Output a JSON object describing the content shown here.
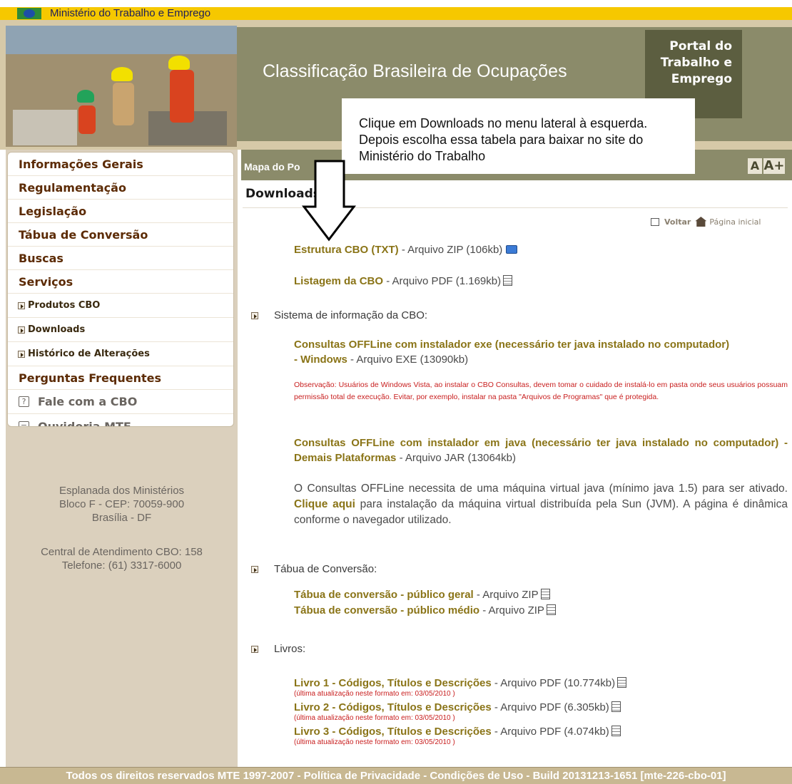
{
  "gov_bar": {
    "text": "Ministério do Trabalho e Emprego"
  },
  "header": {
    "site_title": "Classificação Brasileira de Ocupações",
    "portal_line1": "Portal do",
    "portal_line2": "Trabalho e",
    "portal_line3": "Emprego"
  },
  "annotation": {
    "text": "Clique em Downloads no menu lateral à esquerda. Depois escolha essa tabela para baixar no site do Ministério do Trabalho"
  },
  "sidebar": {
    "items": [
      {
        "label": "Informações Gerais"
      },
      {
        "label": "Regulamentação"
      },
      {
        "label": "Legislação"
      },
      {
        "label": "Tábua de Conversão"
      },
      {
        "label": "Buscas"
      },
      {
        "label": "Serviços"
      },
      {
        "label": "Produtos CBO"
      },
      {
        "label": "Downloads"
      },
      {
        "label": "Histórico de Alterações"
      },
      {
        "label": "Perguntas Frequentes"
      },
      {
        "label": "Fale com a CBO"
      },
      {
        "label": "Ouvidoria MTE"
      }
    ],
    "address_1": "Esplanada dos Ministérios",
    "address_2": "Bloco F - CEP: 70059-900",
    "address_3": "Brasília - DF",
    "contact_1": "Central de Atendimento CBO: 158",
    "contact_2": "Telefone: (61) 3317-6000"
  },
  "toolbar": {
    "mapa_label": "Mapa do Po",
    "font_small": "A",
    "font_large": "A+"
  },
  "content": {
    "heading": "Downloads",
    "back_label": "Voltar",
    "home_label": "Página inicial",
    "file1": {
      "link": "Estrutura CBO (TXT)",
      "desc": " - Arquivo ZIP (106kb)"
    },
    "file2": {
      "link": "Listagem da CBO",
      "desc": " - Arquivo PDF (1.169kb)"
    },
    "section_sistema": "Sistema de informação da CBO:",
    "offline_exe": {
      "link_part1": "Consultas OFFLine com instalador exe (necessário ter java instalado no computador)",
      "link_part2": "- Windows",
      "desc": " - Arquivo EXE (13090kb)"
    },
    "observacao": "Observação: Usuários de Windows Vista, ao instalar o CBO Consultas, devem tomar o cuidado de instalá-lo em pasta onde seus usuários possuam permissão total de execução. Evitar, por exemplo, instalar na pasta \"Arquivos de Programas\" que é protegida.",
    "offline_java": {
      "link": "Consultas OFFLine com instalador em java (necessário ter java instalado no computador) - Demais Plataformas",
      "desc": " - Arquivo JAR (13064kb)"
    },
    "jvm_text_1": "O Consultas OFFLine necessita de uma máquina virtual java (mínimo java 1.5) para ser ativado. ",
    "jvm_link": "Clique aqui",
    "jvm_text_2": " para instalação da máquina virtual distribuída pela Sun (JVM). A página é dinâmica conforme o navegador utilizado.",
    "section_tabua": "Tábua de Conversão:",
    "tabua1": {
      "link": "Tábua de conversão - público geral",
      "desc": " - Arquivo ZIP"
    },
    "tabua2": {
      "link": "Tábua de conversão - público médio",
      "desc": " - Arquivo ZIP"
    },
    "section_livros": "Livros:",
    "livro1": {
      "link": "Livro 1 - Códigos, Títulos e Descrições",
      "desc": " - Arquivo PDF (10.774kb)",
      "note": "(última atualização neste formato em: 03/05/2010 )"
    },
    "livro2": {
      "link": "Livro 2 - Códigos, Títulos e Descrições",
      "desc": " - Arquivo PDF (6.305kb)",
      "note": "(última atualização neste formato em: 03/05/2010 )"
    },
    "livro3": {
      "link": "Livro 3 - Códigos, Títulos e Descrições",
      "desc": " - Arquivo PDF (4.074kb)",
      "note": "(última atualização neste formato em: 03/05/2010 )"
    }
  },
  "footer": {
    "text": "Todos os direitos reservados MTE 1997-2007 - Política de Privacidade - Condições de Uso - Build  20131213-1651 [mte-226-cbo-01]"
  },
  "colors": {
    "header_band": "#8b8b6a",
    "sidebar_bg": "#dbd0bd",
    "menu_text": "#5c2b05",
    "link_gold": "#8a7417",
    "note_red": "#c81e1e",
    "gov_yellow": "#f6c800"
  }
}
